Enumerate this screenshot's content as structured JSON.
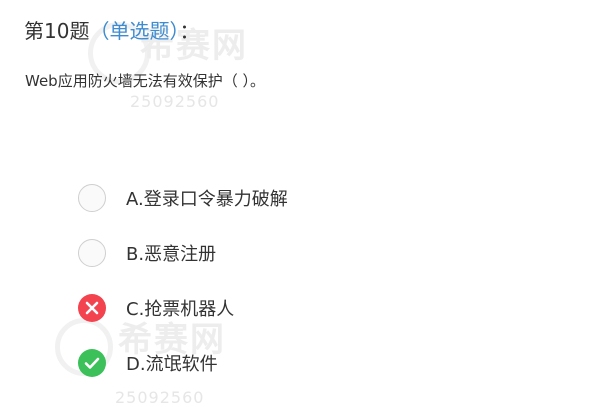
{
  "question": {
    "number_label": "第10题",
    "type_label": "（单选题）",
    "colon": "：",
    "text": "Web应用防火墙无法有效保护（ ）。"
  },
  "options": [
    {
      "label": "A.登录口令暴力破解",
      "state": "unselected",
      "icon": "empty-radio"
    },
    {
      "label": "B.恶意注册",
      "state": "unselected",
      "icon": "empty-radio"
    },
    {
      "label": "C.抢票机器人",
      "state": "wrong",
      "icon": "x-icon"
    },
    {
      "label": "D.流氓软件",
      "state": "correct",
      "icon": "check-icon"
    }
  ],
  "watermark": {
    "brand": "希赛网",
    "id_number": "25092560"
  },
  "colors": {
    "type_label": "#3d8bd1",
    "wrong": "#f2434f",
    "correct": "#3cc05a"
  }
}
